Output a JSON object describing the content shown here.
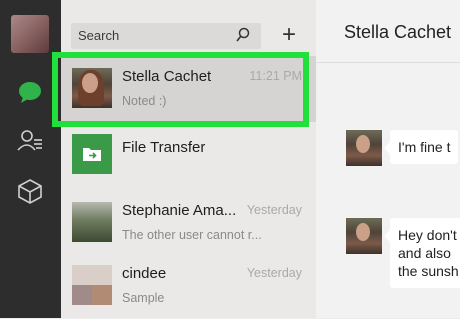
{
  "sidebar": {
    "icons": [
      "profile-avatar",
      "chat-bubble-icon",
      "contacts-icon",
      "box-icon"
    ],
    "accent_color": "#2fb34a"
  },
  "search": {
    "label": "Search"
  },
  "add_button": {
    "label": "+"
  },
  "chats": [
    {
      "name": "Stella Cachet",
      "time": "11:21 PM",
      "preview": "Noted :)",
      "selected": true
    },
    {
      "name": "File Transfer",
      "time": "",
      "preview": ""
    },
    {
      "name": "Stephanie Ama...",
      "time": "Yesterday",
      "preview": "The other user cannot r..."
    },
    {
      "name": "cindee",
      "time": "Yesterday",
      "preview": "Sample"
    }
  ],
  "conversation": {
    "title": "Stella Cachet",
    "messages": [
      {
        "lines": [
          "I'm fine t"
        ]
      },
      {
        "lines": [
          "Hey don't",
          "and also",
          "the sunsh"
        ]
      }
    ]
  },
  "highlight_color": "#22e03c"
}
